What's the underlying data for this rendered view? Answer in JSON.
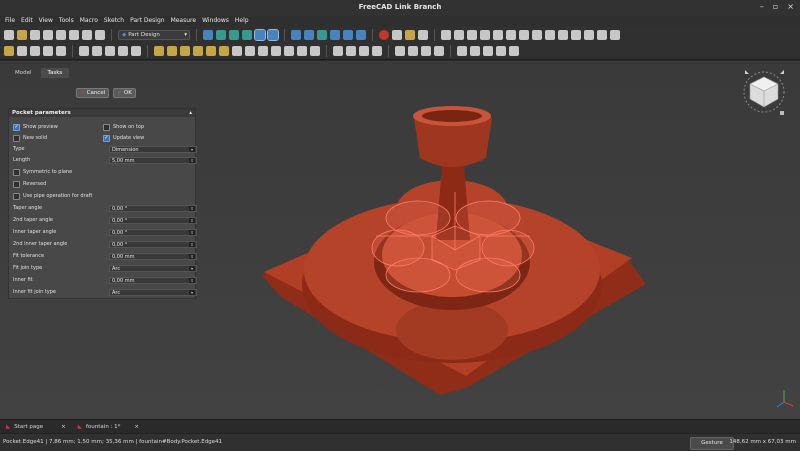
{
  "window": {
    "title": "FreeCAD Link Branch"
  },
  "menu": [
    "File",
    "Edit",
    "View",
    "Tools",
    "Macro",
    "Sketch",
    "Part Design",
    "Measure",
    "Windows",
    "Help"
  ],
  "workbench": "Part Design",
  "combo": {
    "tabs": [
      "Model",
      "Tasks"
    ],
    "cancel_label": "Cancel",
    "ok_label": "OK"
  },
  "pocket": {
    "title": "Pocket parameters",
    "show_preview": "Show preview",
    "show_on_top": "Show on top",
    "new_solid": "New solid",
    "update_view": "Update view",
    "type_label": "Type",
    "type_value": "Dimension",
    "length_label": "Length",
    "length_value": "5,00 mm",
    "symmetric": "Symmetric to plane",
    "reversed": "Reversed",
    "pipe": "Use pipe operation for draft",
    "taper_label": "Taper angle",
    "taper_value": "0,00 °",
    "taper2_label": "2nd taper angle",
    "taper2_value": "0,00 °",
    "inner_taper_label": "Inner taper angle",
    "inner_taper_value": "0,00 °",
    "inner_taper2_label": "2nd inner taper angle",
    "inner_taper2_value": "0,00 °",
    "fit_tol_label": "Fit tolerance",
    "fit_tol_value": "0,00 mm",
    "fit_join_label": "Fit join type",
    "fit_join_value": "Arc",
    "inner_fit_label": "Inner fit",
    "inner_fit_value": "0,00 mm",
    "inner_fit_join_label": "Inner fit join type",
    "inner_fit_join_value": "Arc"
  },
  "doc_tabs": [
    "Start page",
    "fountain : 1*"
  ],
  "status": {
    "left": "Pocket.Edge41 | 7,86 mm; 1,50 mm; 35,36 mm | fountain#Body.Pocket.Edge41",
    "gesture": "Gesture",
    "dims": "148,62 mm x 67,03 mm"
  },
  "colors": {
    "model": "#a83a22",
    "highlight": "#ff7060",
    "viewport": "#3c3c3c"
  }
}
